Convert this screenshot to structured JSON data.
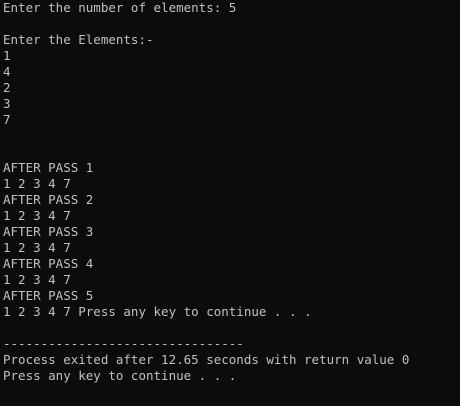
{
  "console": {
    "prompt_elements": "Enter the number of elements: 5",
    "prompt_entries": "Enter the Elements:-",
    "inputs": [
      "1",
      "4",
      "2",
      "3",
      "7"
    ],
    "passes": [
      {
        "label": "AFTER PASS 1",
        "result": "1 2 3 4 7"
      },
      {
        "label": "AFTER PASS 2",
        "result": "1 2 3 4 7"
      },
      {
        "label": "AFTER PASS 3",
        "result": "1 2 3 4 7"
      },
      {
        "label": "AFTER PASS 4",
        "result": "1 2 3 4 7"
      },
      {
        "label": "AFTER PASS 5",
        "result": "1 2 3 4 7 Press any key to continue . . ."
      }
    ],
    "separator": "--------------------------------",
    "exit_message": "Process exited after 12.65 seconds with return value 0",
    "final_prompt": "Press any key to continue . . ."
  },
  "colors": {
    "background": "#0c0c0c",
    "text": "#c0c0c0"
  }
}
